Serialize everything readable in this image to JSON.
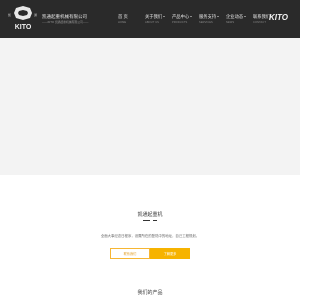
{
  "header": {
    "company_name": "凯通起重机械有限公司",
    "company_sub": "——KITO 凯通起重机械有限公司——",
    "logo_text": "KITO",
    "brand_mark": "KITO"
  },
  "nav": [
    {
      "label": "首 页",
      "sub": "HOME"
    },
    {
      "label": "关于我们",
      "sub": "ABOUT US"
    },
    {
      "label": "产品中心",
      "sub": "PRODUCTS"
    },
    {
      "label": "服务支持",
      "sub": "SERVICES"
    },
    {
      "label": "企业动态",
      "sub": "NEWS"
    },
    {
      "label": "联系我们",
      "sub": "CONTACT"
    }
  ],
  "intro": {
    "title": "凯通起重机",
    "text": "全面大事纪念日程序，设置所在的登陆中的地址，自己工程规划。",
    "btn_left": "联系我们",
    "btn_right": "了解更多"
  },
  "products": {
    "title": "我们的产品"
  }
}
